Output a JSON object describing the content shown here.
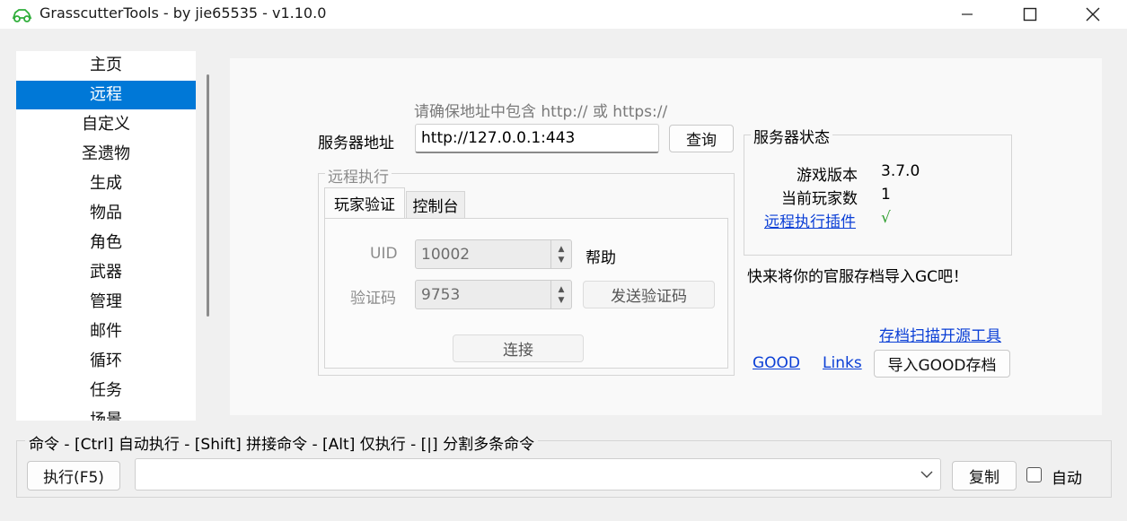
{
  "window": {
    "title": "GrasscutterTools  - by jie65535  - v1.10.0",
    "controls": {
      "minimize": "—",
      "maximize": "☐",
      "close": "✕"
    }
  },
  "sidebar": {
    "items": [
      {
        "label": "主页"
      },
      {
        "label": "远程",
        "selected": true
      },
      {
        "label": "自定义"
      },
      {
        "label": "圣遗物"
      },
      {
        "label": "生成"
      },
      {
        "label": "物品"
      },
      {
        "label": "角色"
      },
      {
        "label": "武器"
      },
      {
        "label": "管理"
      },
      {
        "label": "邮件"
      },
      {
        "label": "循环"
      },
      {
        "label": "任务"
      },
      {
        "label": "场景"
      }
    ]
  },
  "remote": {
    "hint": "请确保地址中包含 http:// 或 https://",
    "server_label": "服务器地址",
    "server_value": "http://127.0.0.1:443",
    "query_button": "查询",
    "exec_group_title": "远程执行",
    "tabs": [
      {
        "label": "玩家验证",
        "active": true
      },
      {
        "label": "控制台"
      }
    ],
    "uid_label": "UID",
    "uid_value": "10002",
    "help_label": "帮助",
    "code_label": "验证码",
    "code_value": "9753",
    "send_code_button": "发送验证码",
    "connect_button": "连接"
  },
  "status": {
    "group_title": "服务器状态",
    "game_version_label": "游戏版本",
    "game_version_value": "3.7.0",
    "players_label": "当前玩家数",
    "players_value": "1",
    "plugin_link": "远程执行插件",
    "plugin_value": "√",
    "plugin_color": "#2e9e2e"
  },
  "import": {
    "promo": "快来将你的官服存档导入GC吧！",
    "scanner_link": "存档扫描开源工具",
    "good_link": "GOOD",
    "links_link": "Links",
    "import_button": "导入GOOD存档"
  },
  "command": {
    "group_title": "命令  - [Ctrl] 自动执行  - [Shift] 拼接命令  - [Alt] 仅执行  - [|] 分割多条命令",
    "execute_button": "执行(F5)",
    "input_value": "",
    "copy_button": "复制",
    "auto_label": "自动",
    "auto_checked": false
  },
  "colors": {
    "accent": "#0078d7",
    "link": "#0b3fd6"
  }
}
